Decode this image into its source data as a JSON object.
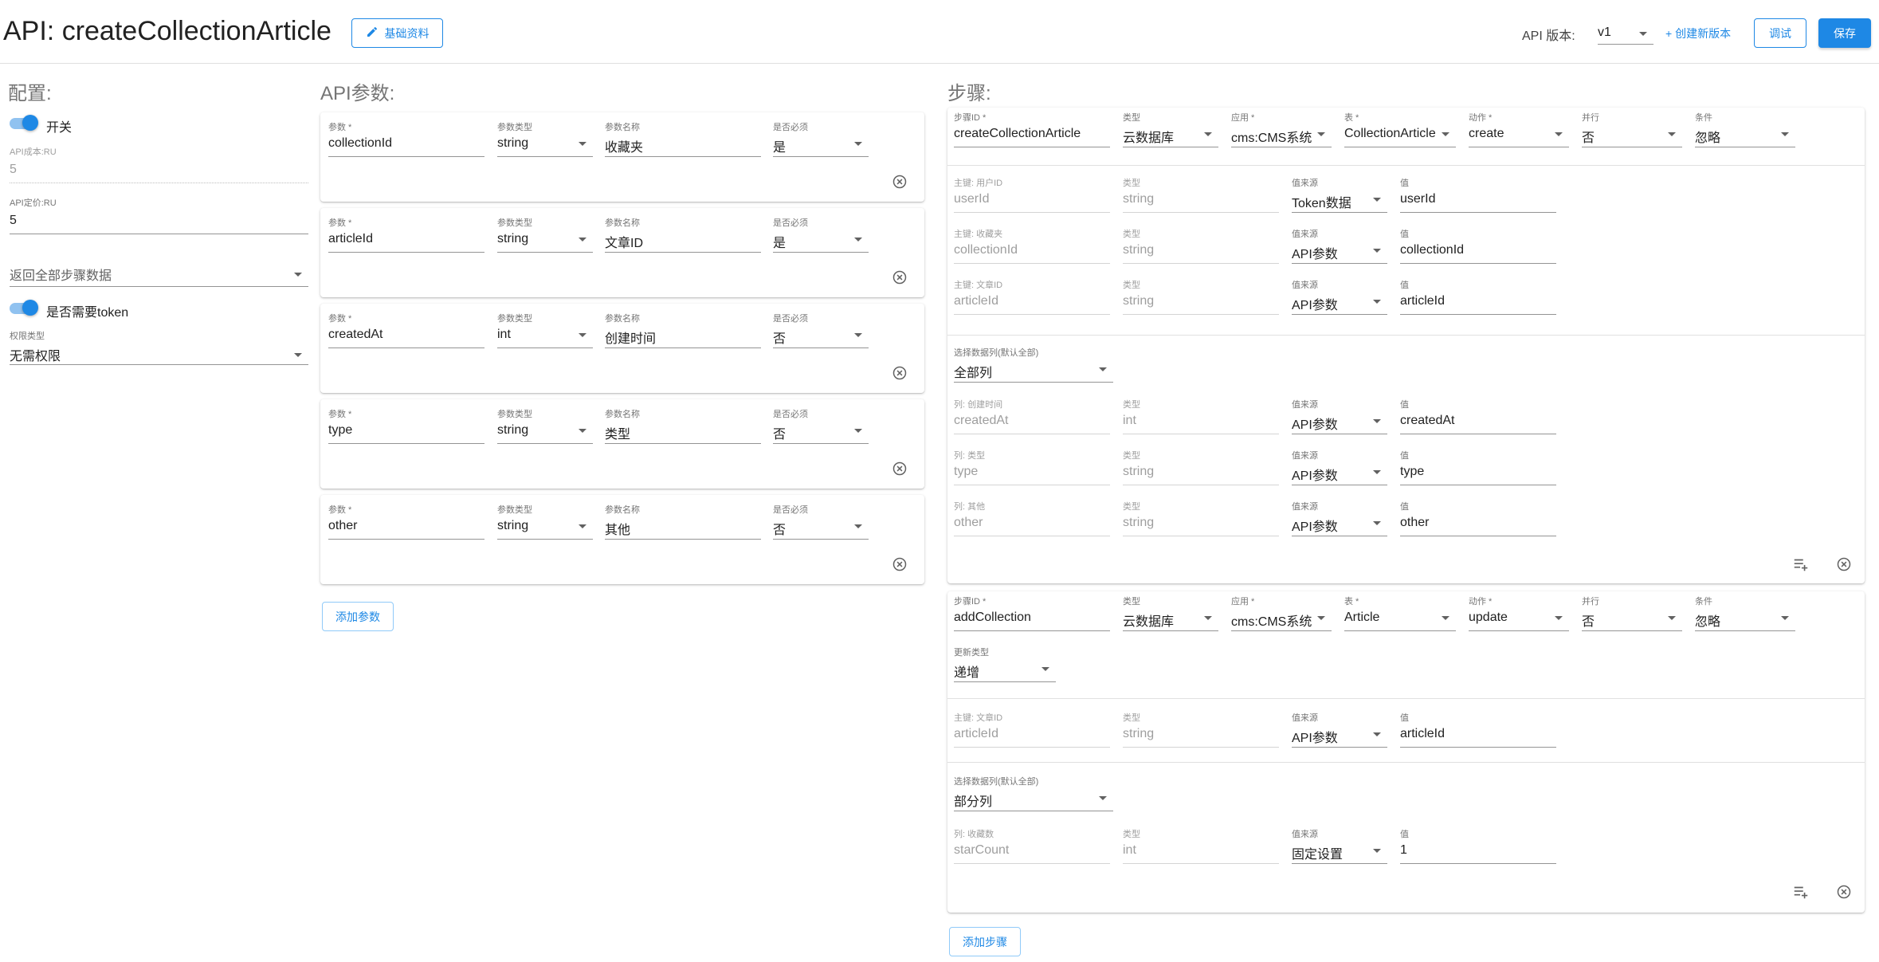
{
  "header": {
    "title": "API: createCollectionArticle",
    "basic_info_label": "基础资料",
    "version_label": "API 版本:",
    "version_value": "v1",
    "new_version_label": "+ 创建新版本",
    "debug_label": "调试",
    "save_label": "保存"
  },
  "config": {
    "title": "配置:",
    "switch_label": "开关",
    "api_cost_label": "API成本:RU",
    "api_cost_value": "5",
    "api_price_label": "API定价:RU",
    "api_price_value": "5",
    "return_select": "返回全部步骤数据",
    "token_label": "是否需要token",
    "permission_label": "权限类型",
    "permission_value": "无需权限"
  },
  "params": {
    "title": "API参数:",
    "labels": {
      "param": "参数 *",
      "type": "参数类型",
      "name": "参数名称",
      "required": "是否必须"
    },
    "items": [
      {
        "param": "collectionId",
        "type": "string",
        "name": "收藏夹",
        "required": "是"
      },
      {
        "param": "articleId",
        "type": "string",
        "name": "文章ID",
        "required": "是"
      },
      {
        "param": "createdAt",
        "type": "int",
        "name": "创建时间",
        "required": "否"
      },
      {
        "param": "type",
        "type": "string",
        "name": "类型",
        "required": "否"
      },
      {
        "param": "other",
        "type": "string",
        "name": "其他",
        "required": "否"
      }
    ],
    "add_label": "添加参数"
  },
  "steps": {
    "title": "步骤:",
    "labels": {
      "step_id": "步骤ID *",
      "type": "类型",
      "app": "应用 *",
      "table": "表 *",
      "action": "动作 *",
      "parallel": "并行",
      "condition": "条件",
      "value_source": "值来源",
      "value": "值",
      "select_columns": "选择数据列(默认全部)",
      "update_type": "更新类型"
    },
    "step1": {
      "step_id": "createCollectionArticle",
      "type": "云数据库",
      "app": "cms:CMS系统",
      "table": "CollectionArticle",
      "action": "create",
      "parallel": "否",
      "condition": "忽略",
      "keys": [
        {
          "label": "主键: 用户ID",
          "name": "userId",
          "type": "string",
          "source": "Token数据",
          "value": "userId"
        },
        {
          "label": "主键: 收藏夹",
          "name": "collectionId",
          "type": "string",
          "source": "API参数",
          "value": "collectionId"
        },
        {
          "label": "主键: 文章ID",
          "name": "articleId",
          "type": "string",
          "source": "API参数",
          "value": "articleId"
        }
      ],
      "columns_select": "全部列",
      "columns": [
        {
          "label": "列: 创建时间",
          "name": "createdAt",
          "type": "int",
          "source": "API参数",
          "value": "createdAt"
        },
        {
          "label": "列: 类型",
          "name": "type",
          "type": "string",
          "source": "API参数",
          "value": "type"
        },
        {
          "label": "列: 其他",
          "name": "other",
          "type": "string",
          "source": "API参数",
          "value": "other"
        }
      ]
    },
    "step2": {
      "step_id": "addCollection",
      "type": "云数据库",
      "app": "cms:CMS系统",
      "table": "Article",
      "action": "update",
      "parallel": "否",
      "condition": "忽略",
      "update_type": "递增",
      "keys": [
        {
          "label": "主键: 文章ID",
          "name": "articleId",
          "type": "string",
          "source": "API参数",
          "value": "articleId"
        }
      ],
      "columns_select": "部分列",
      "columns": [
        {
          "label": "列: 收藏数",
          "name": "starCount",
          "type": "int",
          "source": "固定设置",
          "value": "1"
        }
      ]
    },
    "add_label": "添加步骤"
  }
}
